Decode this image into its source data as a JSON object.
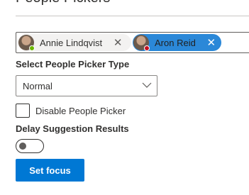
{
  "header": {
    "title": "People Pickers"
  },
  "picker": {
    "selected": [
      {
        "name": "Annie Lindqvist",
        "remove_glyph": "✕",
        "presence": "online",
        "presence_color": "#6bb700",
        "highlighted": false
      },
      {
        "name": "Aron Reid",
        "remove_glyph": "✕",
        "presence": "busy",
        "presence_color": "#c50f1f",
        "highlighted": true
      }
    ]
  },
  "picker_type": {
    "label": "Select People Picker Type",
    "value": "Normal",
    "icon": "chevron-down-icon"
  },
  "disable": {
    "label": "Disable People Picker",
    "checked": false
  },
  "delay": {
    "label": "Delay Suggestion Results",
    "on": false
  },
  "actions": {
    "set_focus": "Set focus"
  },
  "colors": {
    "accent": "#0078d4",
    "selected_chip": "#2b88d8"
  }
}
